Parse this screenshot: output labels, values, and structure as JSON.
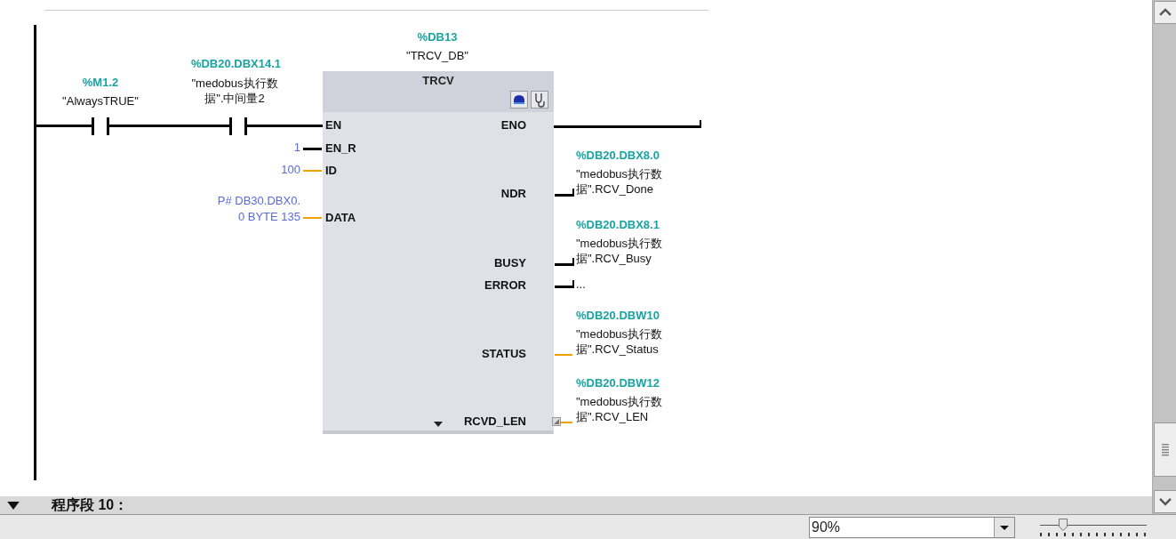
{
  "rung": {
    "contacts": [
      {
        "address": "%DB20.DBX14.1",
        "symbol": "\"medobus执行数据\".中间量2"
      }
    ],
    "first_contact": {
      "address": "%M1.2",
      "symbol": "\"AlwaysTRUE\""
    },
    "block": {
      "instance_address": "%DB13",
      "instance_name": "\"TRCV_DB\"",
      "type": "TRCV",
      "inputs": [
        {
          "pin": "EN",
          "kind": "flow"
        },
        {
          "pin": "EN_R",
          "kind": "bool",
          "value": "1"
        },
        {
          "pin": "ID",
          "kind": "word",
          "value": "100"
        },
        {
          "pin": "DATA",
          "kind": "word",
          "value": "P# DB30.DBX0.0 BYTE 135"
        }
      ],
      "outputs": [
        {
          "pin": "ENO",
          "kind": "flow"
        },
        {
          "pin": "NDR",
          "kind": "bool",
          "address": "%DB20.DBX8.0",
          "symbol": "\"medobus执行数据\".RCV_Done"
        },
        {
          "pin": "BUSY",
          "kind": "bool",
          "address": "%DB20.DBX8.1",
          "symbol": "\"medobus执行数据\".RCV_Busy"
        },
        {
          "pin": "ERROR",
          "kind": "bool",
          "value": "..."
        },
        {
          "pin": "STATUS",
          "kind": "word",
          "address": "%DB20.DBW10",
          "symbol": "\"medobus执行数据\".RCV_Status"
        },
        {
          "pin": "RCVD_LEN",
          "kind": "word",
          "address": "%DB20.DBW12",
          "symbol": "\"medobus执行数据\".RCV_LEN"
        }
      ]
    }
  },
  "next_network": {
    "title": "程序段 10：",
    "expanded": true
  },
  "status_bar": {
    "zoom": "90%",
    "zoom_slider": {
      "level": 0.22
    }
  }
}
